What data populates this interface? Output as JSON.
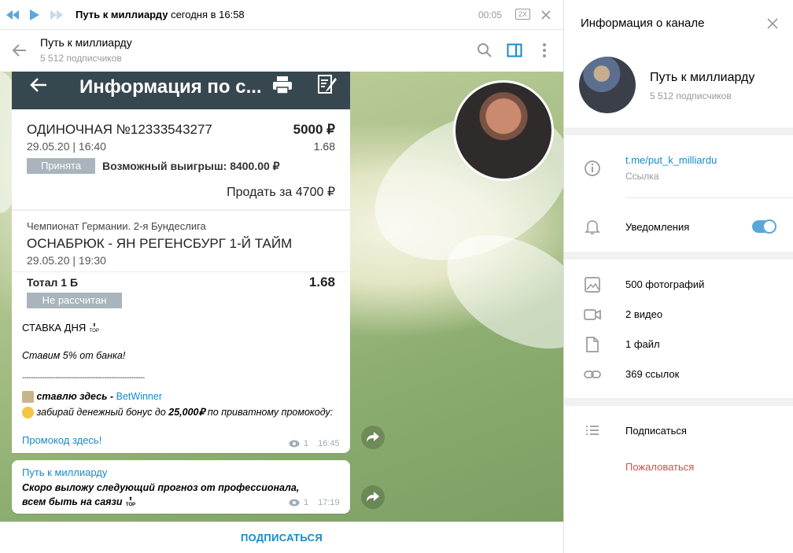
{
  "player": {
    "title": "Путь к миллиарду",
    "time_label": "сегодня в 16:58",
    "position": "00:05",
    "speed": "2X"
  },
  "header": {
    "title": "Путь к миллиарду",
    "subtitle": "5 512 подписчиков"
  },
  "bet_image": {
    "bar_title": "Информация по с...",
    "bet_id": "ОДИНОЧНАЯ №12333543277",
    "bet_amount": "5000 ₽",
    "bet_datetime": "29.05.20 | 16:40",
    "bet_coef": "1.68",
    "status": "Принята",
    "possible_win": "Возможный выигрыш: 8400.00 ₽",
    "sell": "Продать за 4700 ₽",
    "league": "Чемпионат Германии. 2-я Бундеслига",
    "match": "ОСНАБРЮК - ЯН РЕГЕНСБУРГ 1-Й ТАЙМ",
    "match_datetime": "29.05.20 | 19:30",
    "market": "Тотал 1 Б",
    "market_coef": "1.68",
    "market_status": "Не рассчитан"
  },
  "message1": {
    "line1": "СТАВКА ДНЯ",
    "line2": "Ставим 5% от банка!",
    "separator": "-------------------------------------------------------",
    "line3_prefix": "ставлю здесь - ",
    "line3_link": "BetWinner",
    "line4_prefix": "забирай денежный бонус до ",
    "line4_bold": "25,000₽",
    "line4_suffix": " по приватному промокоду:",
    "promo_link": "Промокод здесь!",
    "views": "1",
    "time": "16:45"
  },
  "message2": {
    "reply_name": "Путь к миллиарду",
    "text": "Скоро выложу следующий прогноз от профессионала, всем быть на саязи",
    "views": "1",
    "time": "17:19"
  },
  "subscribe_bar": {
    "label": "ПОДПИСАТЬСЯ"
  },
  "panel": {
    "title": "Информация о канале",
    "channel_name": "Путь к миллиарду",
    "channel_subs": "5 512 подписчиков",
    "link_value": "t.me/put_k_milliardu",
    "link_caption": "Ссылка",
    "notifications": "Уведомления",
    "notifications_on": true,
    "photos": "500 фотографий",
    "videos": "2 видео",
    "files": "1 файл",
    "links": "369 ссылок",
    "subscribe": "Подписаться",
    "report": "Пожаловаться"
  },
  "colors": {
    "accent": "#168acd",
    "danger": "#d14e4e",
    "bar_dark": "#37474f",
    "toggle": "#5aa7dc"
  }
}
